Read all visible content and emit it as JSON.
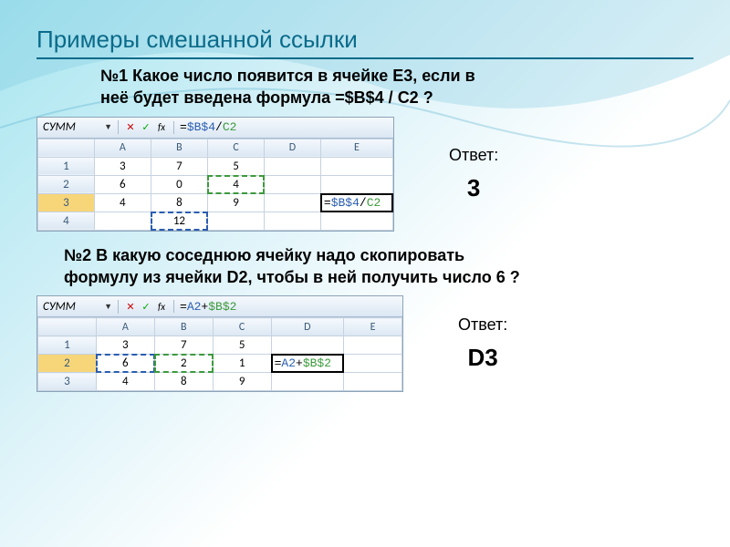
{
  "title": "Примеры смешанной ссылки",
  "q1": {
    "text_l1": "№1 Какое число появится в ячейке E3, если в",
    "text_l2": "неё будет введена формула =$B$4 / C2 ?",
    "answer_label": "Ответ:",
    "answer_value": "3"
  },
  "q2": {
    "text_l1": "№2 В какую соседнюю ячейку надо скопировать",
    "text_l2": "формулу из ячейки D2, чтобы в ней получить число 6 ?",
    "answer_label": "Ответ:",
    "answer_value": "D3"
  },
  "excel1": {
    "namebox": "СУММ",
    "fx_label": "fx",
    "formula": "=$B$4/C2",
    "formula_b": "$B$4",
    "formula_c": "C2",
    "cols": [
      "A",
      "B",
      "C",
      "D",
      "E"
    ],
    "rows": {
      "1": [
        "3",
        "7",
        "5",
        "",
        ""
      ],
      "2": [
        "6",
        "0",
        "4",
        "",
        ""
      ],
      "3": [
        "4",
        "8",
        "9",
        "",
        "=$B$4/C2"
      ],
      "4": [
        "",
        "12",
        "",
        "",
        ""
      ]
    },
    "cell_formula": "=$B$4/C2"
  },
  "excel2": {
    "namebox": "СУММ",
    "fx_label": "fx",
    "formula": "=A2+$B$2",
    "formula_a": "A2",
    "formula_b": "$B$2",
    "cols": [
      "A",
      "B",
      "C",
      "D",
      "E"
    ],
    "rows": {
      "1": [
        "3",
        "7",
        "5",
        "",
        ""
      ],
      "2": [
        "6",
        "2",
        "1",
        "=A2+$B$2",
        ""
      ],
      "3": [
        "4",
        "8",
        "9",
        "",
        ""
      ]
    },
    "cell_formula": "=A2+$B$2"
  }
}
